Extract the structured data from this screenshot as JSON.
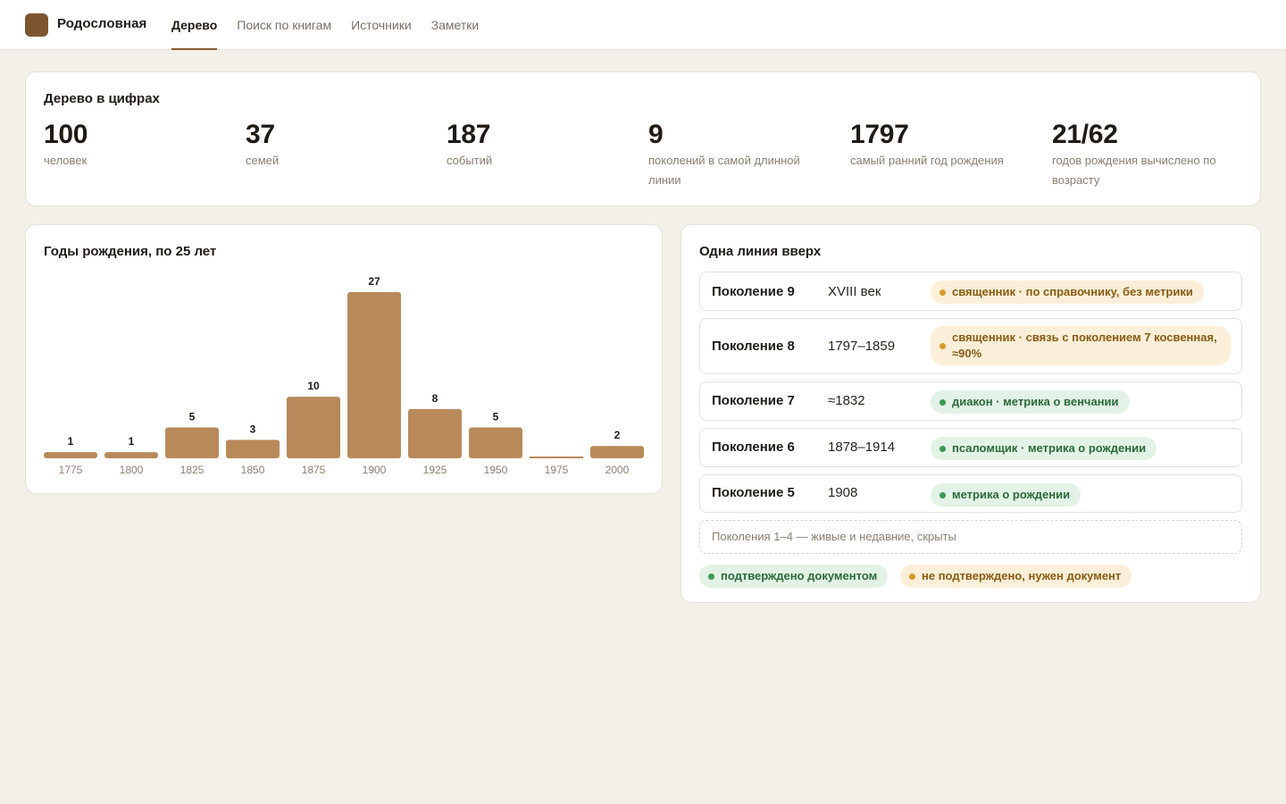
{
  "header": {
    "brand": "Родословная",
    "nav": [
      {
        "label": "Дерево",
        "active": true
      },
      {
        "label": "Поиск по книгам",
        "active": false
      },
      {
        "label": "Источники",
        "active": false
      },
      {
        "label": "Заметки",
        "active": false
      }
    ]
  },
  "stats": {
    "title": "Дерево в цифрах",
    "items": [
      {
        "value": "100",
        "label": "человек"
      },
      {
        "value": "37",
        "label": "семей"
      },
      {
        "value": "187",
        "label": "событий"
      },
      {
        "value": "9",
        "label": "поколений в самой длинной линии"
      },
      {
        "value": "1797",
        "label": "самый ранний год рождения"
      },
      {
        "value": "21/62",
        "label": "годов рождения вычислено по возрасту"
      }
    ]
  },
  "chart_data": {
    "type": "bar",
    "title": "Годы рождения, по 25 лет",
    "categories": [
      "1775",
      "1800",
      "1825",
      "1850",
      "1875",
      "1900",
      "1925",
      "1950",
      "1975",
      "2000"
    ],
    "values": [
      1,
      1,
      5,
      3,
      10,
      27,
      8,
      5,
      0,
      2
    ],
    "value_labels": [
      "1",
      "1",
      "5",
      "3",
      "10",
      "27",
      "8",
      "5",
      "",
      "2"
    ],
    "ylim": [
      0,
      27
    ],
    "grid": false,
    "bar_color": "#b88a5a"
  },
  "lineage": {
    "title": "Одна линия вверх",
    "rows": [
      {
        "name": "Поколение 9",
        "years": "XVIII век",
        "badge": "священник · по справочнику, без метрики",
        "status": "warn"
      },
      {
        "name": "Поколение 8",
        "years": "1797–1859",
        "badge": "священник · связь с поколением 7 косвенная, ≈90%",
        "status": "warn"
      },
      {
        "name": "Поколение 7",
        "years": "≈1832",
        "badge": "диакон · метрика о венчании",
        "status": "ok"
      },
      {
        "name": "Поколение 6",
        "years": "1878–1914",
        "badge": "псаломщик · метрика о рождении",
        "status": "ok"
      },
      {
        "name": "Поколение 5",
        "years": "1908",
        "badge": "метрика о рождении",
        "status": "ok"
      }
    ],
    "hidden_note": "Поколения 1–4 — живые и недавние, скрыты",
    "legend": [
      {
        "label": "подтверждено документом",
        "status": "ok"
      },
      {
        "label": "не подтверждено, нужен документ",
        "status": "warn"
      }
    ]
  },
  "colors": {
    "accent": "#8a5a32",
    "bar": "#b88a5a",
    "ok": "#3a9a52",
    "warn": "#d69a2c",
    "background": "#f3f0ea"
  }
}
